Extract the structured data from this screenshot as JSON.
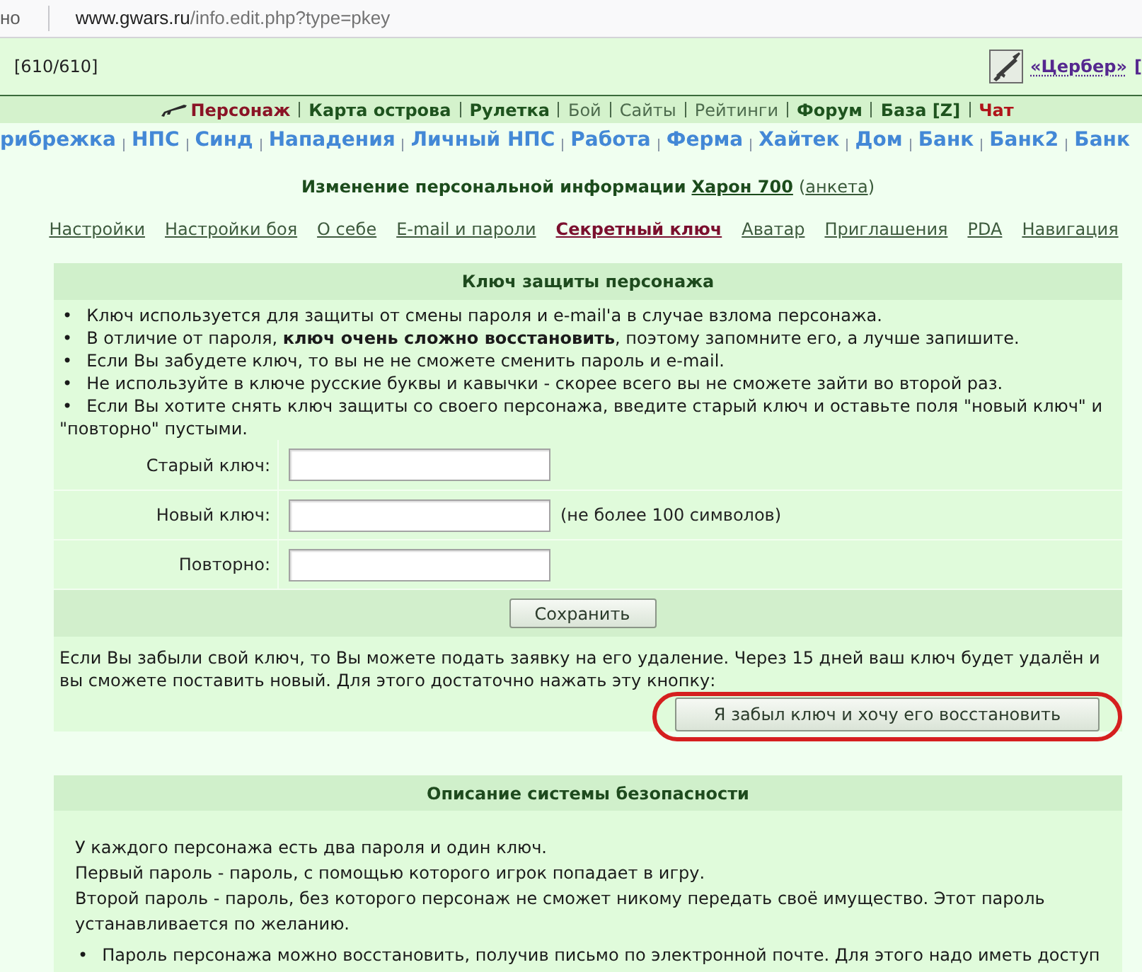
{
  "browser": {
    "security_label": "но",
    "url_host": "www.gwars.ru",
    "url_path": "/info.edit.php?type=pkey"
  },
  "header": {
    "health": "[610/610]",
    "clan_link": "«Цербер»",
    "cut_text": "["
  },
  "main_nav": [
    {
      "label": "Персонаж",
      "kind": "current"
    },
    {
      "label": "Карта острова",
      "kind": "bold"
    },
    {
      "label": "Рулетка",
      "kind": "bold"
    },
    {
      "label": "Бой",
      "kind": "plain"
    },
    {
      "label": "Сайты",
      "kind": "plain"
    },
    {
      "label": "Рейтинги",
      "kind": "plain"
    },
    {
      "label": "Форум",
      "kind": "bold"
    },
    {
      "label": "База [Z]",
      "kind": "bold"
    },
    {
      "label": "Чат",
      "kind": "alert"
    }
  ],
  "location_nav": [
    "рибрежка",
    "НПС",
    "Синд",
    "Нападения",
    "Личный НПС",
    "Работа",
    "Ферма",
    "Хайтек",
    "Дом",
    "Банк",
    "Банк2",
    "Банк"
  ],
  "page_title": {
    "heading": "Изменение персональной информации",
    "character_link": "Харон 700",
    "paren_open": "(",
    "profile_link": "анкета",
    "paren_close": ")"
  },
  "settings_tabs": [
    {
      "label": "Настройки",
      "selected": false
    },
    {
      "label": "Настройки боя",
      "selected": false
    },
    {
      "label": "О себе",
      "selected": false
    },
    {
      "label": "E-mail и пароли",
      "selected": false
    },
    {
      "label": "Секретный ключ",
      "selected": true
    },
    {
      "label": "Аватар",
      "selected": false
    },
    {
      "label": "Приглашения",
      "selected": false
    },
    {
      "label": "PDA",
      "selected": false
    },
    {
      "label": "Навигация",
      "selected": false
    }
  ],
  "key_panel": {
    "title": "Ключ защиты персонажа",
    "notes": [
      {
        "bullet": "•",
        "text": "Ключ используется для защиты от смены пароля и e-mail'a в случае взлома персонажа."
      },
      {
        "bullet": "•",
        "text": "В отличие от пароля, **ключ очень сложно восстановить**, поэтому запомните его, а лучше запишите."
      },
      {
        "bullet": "•",
        "text": "Если Вы забудете ключ, то вы не не сможете сменить пароль и e-mail."
      },
      {
        "bullet": "•",
        "text": "Не используйте в ключе русские буквы и кавычки - скорее всего вы не сможете зайти во второй раз."
      },
      {
        "bullet": "•",
        "text": "Если Вы хотите снять ключ защиты со своего персонажа, введите старый ключ и оставьте поля \"новый ключ\" и \"повторно\" пустыми."
      }
    ],
    "fields": [
      {
        "label": "Старый ключ:"
      },
      {
        "label": "Новый ключ:",
        "note": "(не более 100 символов)"
      },
      {
        "label": "Повторно:"
      }
    ],
    "save_button": "Сохранить",
    "forgot_text": "Если Вы забыли свой ключ, то Вы можете подать заявку на его удаление. Через 15 дней ваш ключ будет удалён и вы сможете поставить новый. Для этого достаточно нажать эту кнопку:",
    "forgot_button": {
      "label": "Я забыл ключ и хочу его восстановить",
      "highlighted": true
    }
  },
  "security_panel": {
    "title": "Описание системы безопасности",
    "paragraphs": [
      "У каждого персонажа есть два пароля и один ключ.",
      "Первый пароль - пароль, с помощью которого игрок попадает в игру.",
      "Второй пароль - пароль, без которого персонаж не сможет никому передать своё имущество. Этот пароль устанавливается по желанию."
    ],
    "bullets": [
      {
        "bullet": "•",
        "text": "Пароль персонажа можно восстановить, получив письмо по электронной почте. Для этого надо иметь доступ"
      }
    ]
  }
}
